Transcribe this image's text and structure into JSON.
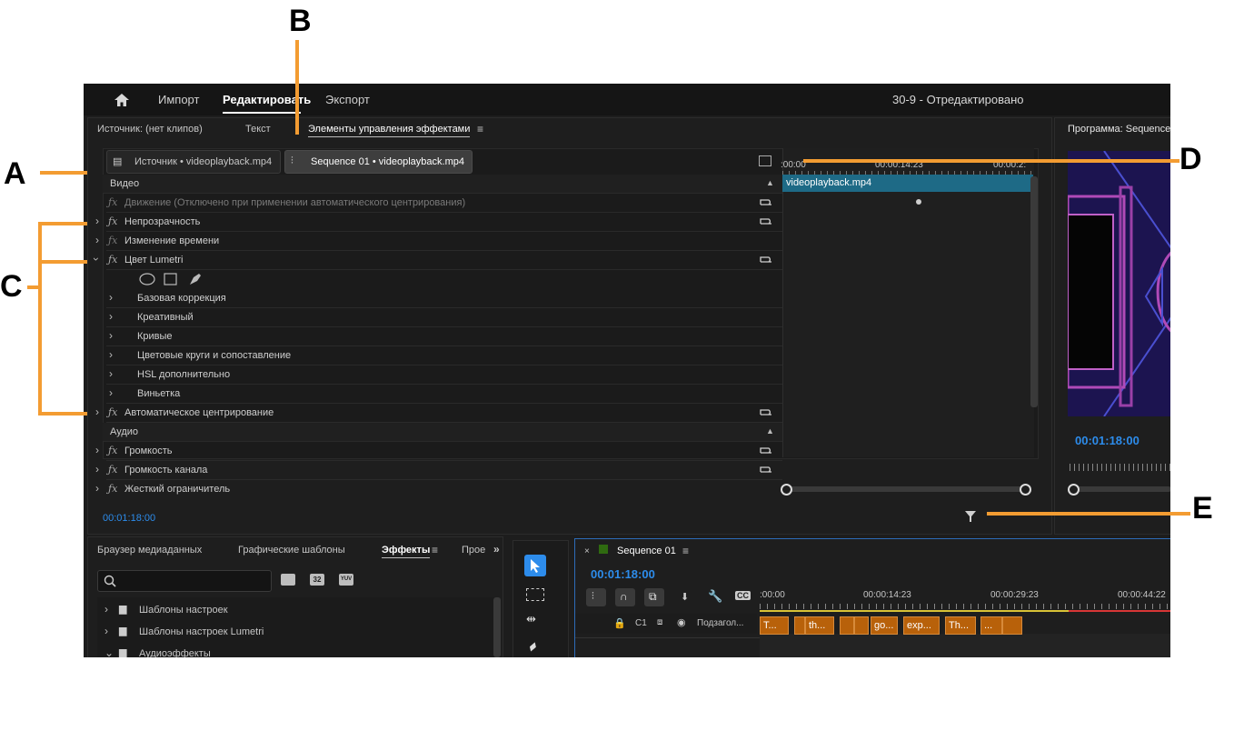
{
  "topbar": {
    "nav_import": "Импорт",
    "nav_edit": "Редактировать",
    "nav_export": "Экспорт",
    "project_title": "30-9 - Отредактировано"
  },
  "effect_controls": {
    "tab_source": "Источник: (нет клипов)",
    "tab_text": "Текст",
    "tab_effects": "Элементы управления эффектами",
    "source_chip": "Источник • videoplayback.mp4",
    "sequence_chip": "Sequence 01 • videoplayback.mp4",
    "section_video": "Видео",
    "section_audio": "Аудио",
    "rows": [
      {
        "label": "Движение  (Отключено при применении автоматического центрирования)"
      },
      {
        "label": "Непрозрачность"
      },
      {
        "label": "Изменение времени"
      },
      {
        "label": "Цвет Lumetri"
      },
      {
        "label": "Базовая коррекция"
      },
      {
        "label": "Креативный"
      },
      {
        "label": "Кривые"
      },
      {
        "label": "Цветовые круги и сопоставление"
      },
      {
        "label": "HSL дополнительно"
      },
      {
        "label": "Виньетка"
      },
      {
        "label": "Автоматическое центрирование"
      },
      {
        "label": "Громкость"
      },
      {
        "label": "Громкость канала"
      },
      {
        "label": "Жесткий ограничитель"
      }
    ],
    "timeline_ticks": [
      ":00:00",
      "00:00:14:23",
      "00:00:2:"
    ],
    "clip_name": "videoplayback.mp4",
    "timecode": "00:01:18:00"
  },
  "program": {
    "title": "Программа: Sequence",
    "timecode": "00:01:18:00"
  },
  "bottom_left": {
    "tab_media": "Браузер медиаданных",
    "tab_graphics": "Графические шаблоны",
    "tab_effects": "Эффекты",
    "tab_project": "Прое",
    "items": [
      "Шаблоны настроек",
      "Шаблоны настроек Lumetri",
      "Аудиоэффекты"
    ],
    "badge_32": "32",
    "badge_yuv": "YUV"
  },
  "sequence": {
    "tab": "Sequence 01",
    "timecode": "00:01:18:00",
    "ruler": [
      ":00:00",
      "00:00:14:23",
      "00:00:29:23",
      "00:00:44:22"
    ],
    "track_c1": "C1",
    "track_label": "Подзагол...",
    "clips": [
      "T...",
      "",
      "th...",
      "",
      "",
      "go...",
      "exp...",
      "Th...",
      "...",
      ""
    ]
  },
  "callouts": {
    "a": "A",
    "b": "B",
    "c": "C",
    "d": "D",
    "e": "E"
  },
  "colors": {
    "accent_blue": "#2d8ceb",
    "marker_orange": "#f39c32",
    "clip_orange": "#b8610a"
  }
}
